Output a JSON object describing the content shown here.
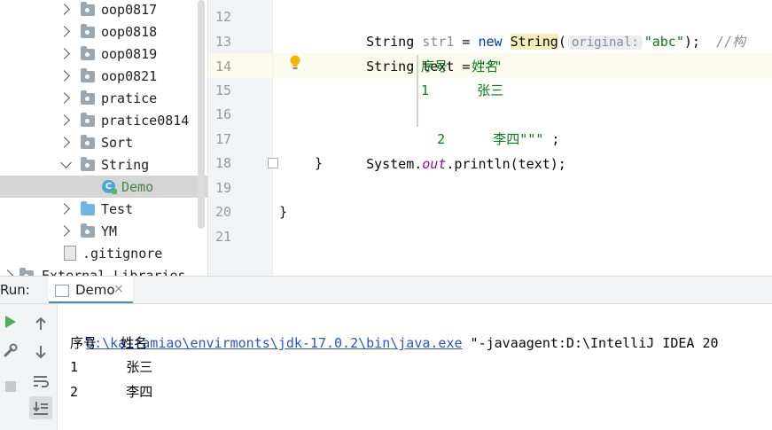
{
  "project_tree": {
    "items": [
      {
        "label": "oop0817",
        "kind": "package",
        "state": "collapsed"
      },
      {
        "label": "oop0818",
        "kind": "package",
        "state": "collapsed"
      },
      {
        "label": "oop0819",
        "kind": "package",
        "state": "collapsed"
      },
      {
        "label": "oop0821",
        "kind": "package",
        "state": "collapsed"
      },
      {
        "label": "pratice",
        "kind": "package",
        "state": "collapsed"
      },
      {
        "label": "pratice0814",
        "kind": "package",
        "state": "collapsed"
      },
      {
        "label": "Sort",
        "kind": "package",
        "state": "collapsed"
      },
      {
        "label": "String",
        "kind": "package",
        "state": "expanded"
      },
      {
        "label": "Demo",
        "kind": "class",
        "state": "selected"
      },
      {
        "label": "Test",
        "kind": "folder",
        "state": "collapsed"
      },
      {
        "label": "YM",
        "kind": "package",
        "state": "collapsed"
      },
      {
        "label": ".gitignore",
        "kind": "file",
        "state": "none"
      },
      {
        "label": "External Libraries",
        "kind": "libraries",
        "state": "collapsed"
      }
    ]
  },
  "editor": {
    "line_numbers": [
      "12",
      "13",
      "14",
      "15",
      "16",
      "17",
      "18",
      "19",
      "20",
      "21"
    ],
    "code": {
      "l12_type": "String ",
      "l12_var": "str1",
      "l12_assign": " = ",
      "l12_new": "new",
      "l12_ctor": "String",
      "l12_open": "(",
      "l12_hint": "original:",
      "l12_arg": "\"abc\"",
      "l12_close": ");  ",
      "l12_comment": "//构",
      "l13_decl": "String text = ",
      "l13_str": "\"\"\"",
      "l14_text": "序号   姓名",
      "l15_text": "1      张三",
      "l16_text": "2      李四\"\"\"",
      "l16_end": " ;",
      "l17_a": "System.",
      "l17_out": "out",
      "l17_b": ".println(text);",
      "l18": "}",
      "l20": "}"
    },
    "current_line": "14"
  },
  "run_panel": {
    "title": "Run:",
    "tab_label": "Demo",
    "tab_close": "×",
    "command_path": "D:\\kaifamiao\\envirmonts\\jdk-17.0.2\\bin\\java.exe",
    "command_args": " \"-javaagent:D:\\IntelliJ IDEA 20",
    "output": [
      "序号   姓名",
      "1      张三",
      "2      李四"
    ]
  },
  "icons": {
    "run": "run-icon",
    "settings": "wrench-icon",
    "stop": "stop-icon",
    "up": "arrow-up-icon",
    "down": "arrow-down-icon",
    "wrap": "soft-wrap-icon",
    "scroll": "scroll-to-end-icon",
    "bulb": "lightbulb-icon"
  },
  "colors": {
    "keyword": "#0033b3",
    "string": "#067d17",
    "selection": "#d5d5d5",
    "current_line": "#fcfaed",
    "run_green": "#4caf50"
  }
}
